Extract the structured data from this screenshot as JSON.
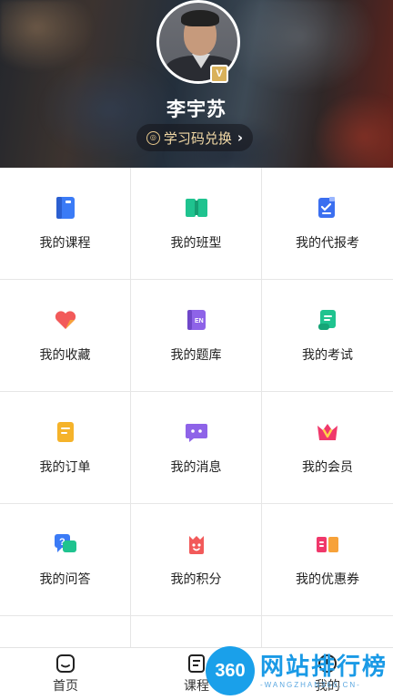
{
  "profile": {
    "name": "李宇苏",
    "vip_badge": "V",
    "redeem_label": "学习码兑换",
    "redeem_coin": "◎",
    "redeem_chevron": "›"
  },
  "menu": [
    {
      "label": "我的课程",
      "icon": "course-book-icon",
      "color": "#3b7bf6"
    },
    {
      "label": "我的班型",
      "icon": "class-book-icon",
      "color": "#1fc38f"
    },
    {
      "label": "我的代报考",
      "icon": "proxy-registration-icon",
      "color": "#3b6ff0"
    },
    {
      "label": "我的收藏",
      "icon": "favorite-heart-icon",
      "color": "#f25a5a"
    },
    {
      "label": "我的题库",
      "icon": "question-bank-icon",
      "color": "#8e63e8"
    },
    {
      "label": "我的考试",
      "icon": "exam-scroll-icon",
      "color": "#1fc38f"
    },
    {
      "label": "我的订单",
      "icon": "order-icon",
      "color": "#f5b32a"
    },
    {
      "label": "我的消息",
      "icon": "message-icon",
      "color": "#8e63e8"
    },
    {
      "label": "我的会员",
      "icon": "membership-crown-icon",
      "color": "#f0386b"
    },
    {
      "label": "我的问答",
      "icon": "qa-bubble-icon",
      "color": "#3b7bf6"
    },
    {
      "label": "我的积分",
      "icon": "points-bag-icon",
      "color": "#f25a5a"
    },
    {
      "label": "我的优惠券",
      "icon": "coupon-icon",
      "color": "#f0386b"
    }
  ],
  "nav": {
    "home_label": "首页",
    "course_label": "课程",
    "mine_label": "我的"
  },
  "watermark": {
    "badge": "360",
    "title": "网站排行榜",
    "subtitle": "-WANGZHAN360.CN-"
  }
}
